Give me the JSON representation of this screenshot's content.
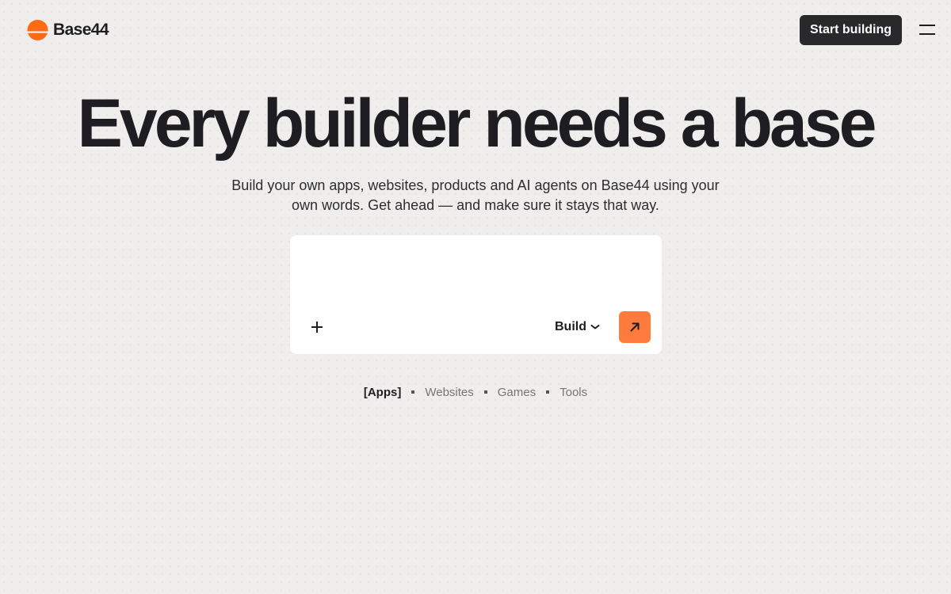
{
  "header": {
    "logo_text": "Base44",
    "start_button": "Start building",
    "menu_icon": "hamburger-menu-icon"
  },
  "hero": {
    "title": "Every builder needs a base",
    "subtitle": "Build your own apps, websites, products and AI agents on Base44 using your own words. Get ahead — and make sure it stays that way."
  },
  "prompt": {
    "placeholder": "",
    "value": "",
    "add_icon": "plus-icon",
    "mode_label": "Build",
    "mode_icon": "chevron-down-icon",
    "send_icon": "arrow-up-right-icon"
  },
  "categories": {
    "items": [
      {
        "label": "[Apps]",
        "active": true
      },
      {
        "label": "Websites",
        "active": false
      },
      {
        "label": "Games",
        "active": false
      },
      {
        "label": "Tools",
        "active": false
      }
    ]
  },
  "colors": {
    "background": "#efeeec",
    "accent": "#ff7a3d",
    "logo": "#ff6a13",
    "dark_button": "#29292b",
    "text": "#1e1e22"
  }
}
